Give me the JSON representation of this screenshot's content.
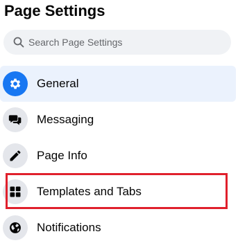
{
  "header": {
    "title": "Page Settings"
  },
  "search": {
    "placeholder": "Search Page Settings",
    "value": ""
  },
  "sidebar": {
    "items": [
      {
        "label": "General",
        "icon": "gear-icon",
        "active": true
      },
      {
        "label": "Messaging",
        "icon": "chat-bubbles-icon",
        "active": false
      },
      {
        "label": "Page Info",
        "icon": "pencil-icon",
        "active": false
      },
      {
        "label": "Templates and Tabs",
        "icon": "grid-icon",
        "active": false,
        "highlighted": true
      },
      {
        "label": "Notifications",
        "icon": "globe-icon",
        "active": false
      }
    ]
  },
  "colors": {
    "accent": "#1877f2",
    "active_bg": "#ebf2fd",
    "icon_bg": "#e4e6eb",
    "search_bg": "#f0f2f5",
    "highlight_border": "#e0202c"
  }
}
